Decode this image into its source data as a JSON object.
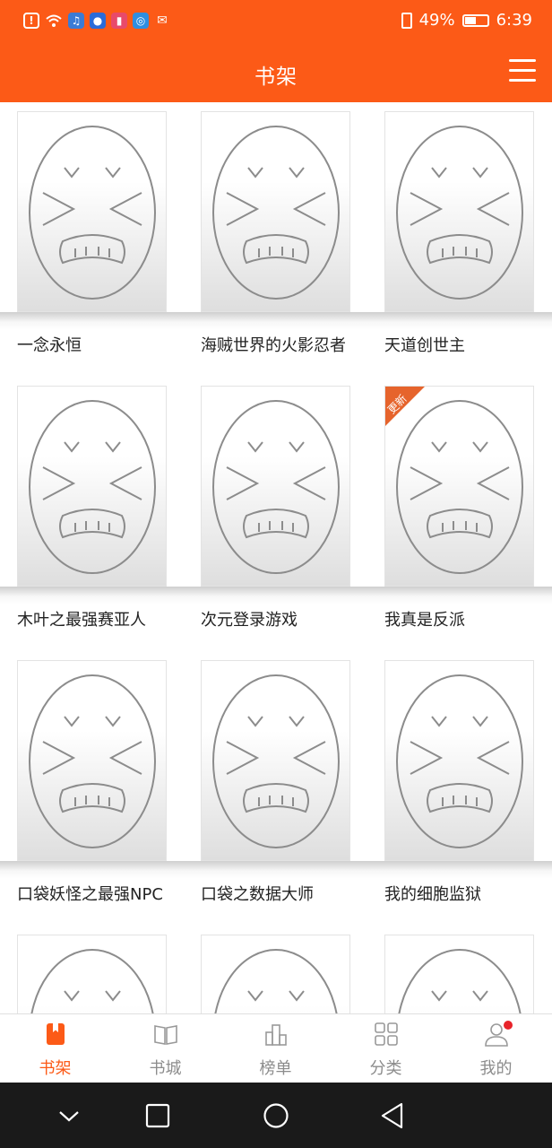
{
  "status_bar": {
    "battery": "49%",
    "battery_level": 0.49,
    "time": "6:39"
  },
  "header": {
    "title": "书架"
  },
  "books": [
    {
      "title": "一念永恒"
    },
    {
      "title": "海贼世界的火影忍者"
    },
    {
      "title": "天道创世主"
    },
    {
      "title": "木叶之最强赛亚人"
    },
    {
      "title": "次元登录游戏"
    },
    {
      "title": "我真是反派"
    },
    {
      "title": "口袋妖怪之最强NPC"
    },
    {
      "title": "口袋之数据大师"
    },
    {
      "title": "我的细胞监狱"
    }
  ],
  "update_badge": "更新",
  "tabs": [
    {
      "label": "书架",
      "icon": "bookshelf-icon",
      "active": true
    },
    {
      "label": "书城",
      "icon": "book-open-icon"
    },
    {
      "label": "榜单",
      "icon": "chart-bars-icon"
    },
    {
      "label": "分类",
      "icon": "grid-icon"
    },
    {
      "label": "我的",
      "icon": "user-icon",
      "badge_dot": true
    }
  ],
  "colors": {
    "accent": "#fc5a17",
    "badge": "#e6642c",
    "dot": "#e8232a"
  }
}
